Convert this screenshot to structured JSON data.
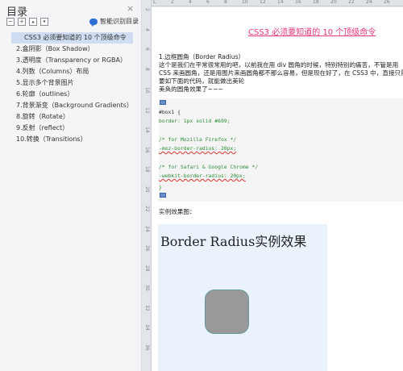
{
  "toc": {
    "title": "目录",
    "close": "×",
    "toolbar_buttons": [
      "−",
      "+",
      "▴",
      "▾"
    ],
    "smart_label": "智能识别目录",
    "items": [
      "CSS3 必须要知道的 10 个顶级命令",
      "2.盒阴影（Box Shadow）",
      "3.透明度（Transparency or RGBA）",
      "4.列数（Columns）布局",
      "5.显示多个背景图片",
      "6.轮廓（outlines）",
      "7.背景渐变（Background Gradients）",
      "8.旋转（Rotate）",
      "9.反射（reflect）",
      "10.转换（Transitions）"
    ]
  },
  "ruler": {
    "vertical": [
      "2",
      "4",
      "6",
      "8",
      "10",
      "12",
      "14",
      "16",
      "18",
      "20",
      "22",
      "24",
      "26",
      "28",
      "30",
      "32",
      "34",
      "36"
    ],
    "horizontal": [
      "L",
      "2",
      "4",
      "6",
      "8",
      "10",
      "12",
      "14",
      "16",
      "18",
      "20",
      "22",
      "24",
      "26"
    ]
  },
  "doc": {
    "title": "CSS3 必须要知道的 10 个顶级命令",
    "section": "1.边框圆角（Border Radius）",
    "para1": "这个是我们在平常很常用的吧，以前我在用 div 圆角的时候，特别特别的痛苦，不管是用",
    "para2": "CSS 来画圆角，还是用图片来画圆角都不那么容易，但是现在好了，在 CSS3 中，直接只需",
    "para3": "要如下面的代码，就能做出美轮",
    "para4": "美奂的圆角效果了~~~",
    "code": [
      "#box1 {",
      "border: 1px solid #699;",
      "",
      "/* for Mozilla Firefox */",
      "-moz-border-radius: 20px;",
      "",
      "/* for Safari & Google Chrome */",
      "-webkit-border-radius: 20px;",
      "}"
    ],
    "demo_label": "实例效果图：",
    "demo_title": "Border Radius实例效果"
  }
}
